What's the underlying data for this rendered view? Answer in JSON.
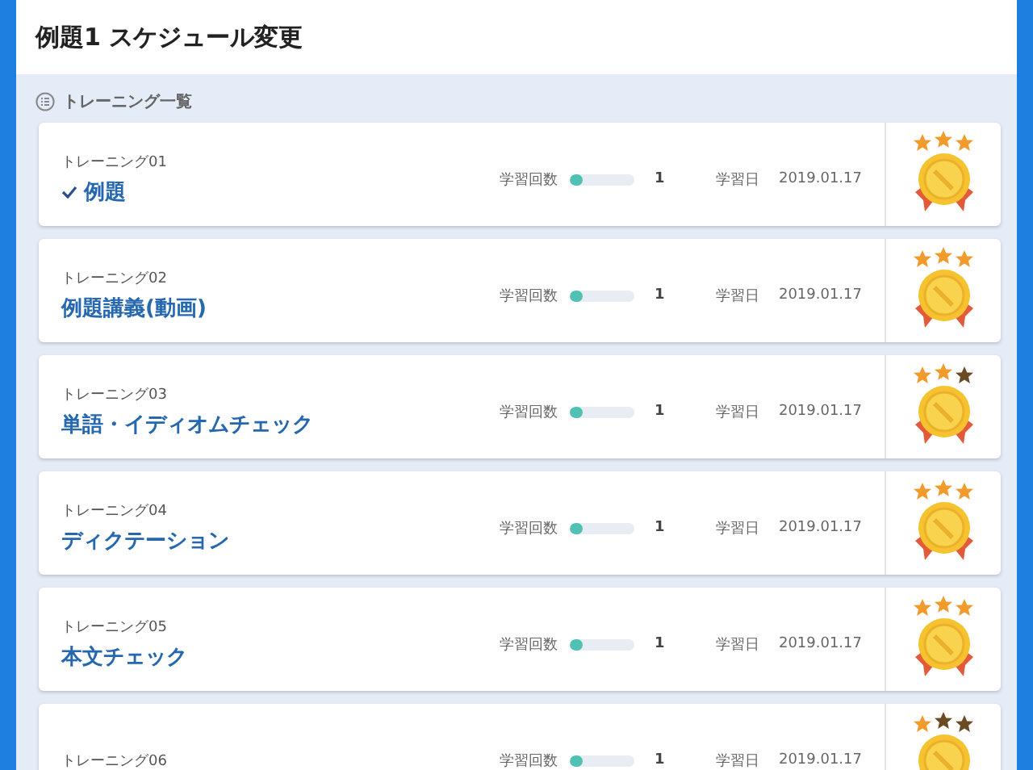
{
  "header": {
    "title": "例題1 スケジュール変更"
  },
  "section": {
    "title": "トレーニング一覧"
  },
  "trainings": [
    {
      "label": "トレーニング01",
      "title": "例題",
      "completed": true,
      "count_label": "学習回数",
      "level": 0.2,
      "count": "1",
      "date_label": "学習日",
      "date": "2019.01.17",
      "stars": 3
    },
    {
      "label": "トレーニング02",
      "title": "例題講義(動画)",
      "completed": false,
      "count_label": "学習回数",
      "level": 0.2,
      "count": "1",
      "date_label": "学習日",
      "date": "2019.01.17",
      "stars": 3
    },
    {
      "label": "トレーニング03",
      "title": "単語・イディオムチェック",
      "completed": false,
      "count_label": "学習回数",
      "level": 0.2,
      "count": "1",
      "date_label": "学習日",
      "date": "2019.01.17",
      "stars": 2
    },
    {
      "label": "トレーニング04",
      "title": "ディクテーション",
      "completed": false,
      "count_label": "学習回数",
      "level": 0.2,
      "count": "1",
      "date_label": "学習日",
      "date": "2019.01.17",
      "stars": 3
    },
    {
      "label": "トレーニング05",
      "title": "本文チェック",
      "completed": false,
      "count_label": "学習回数",
      "level": 0.2,
      "count": "1",
      "date_label": "学習日",
      "date": "2019.01.17",
      "stars": 3
    },
    {
      "label": "トレーニング06",
      "count_label": "学習回数",
      "level": 0.2,
      "count": "1",
      "date_label": "学習日",
      "date": "2019.01.17",
      "stars": 1
    }
  ]
}
